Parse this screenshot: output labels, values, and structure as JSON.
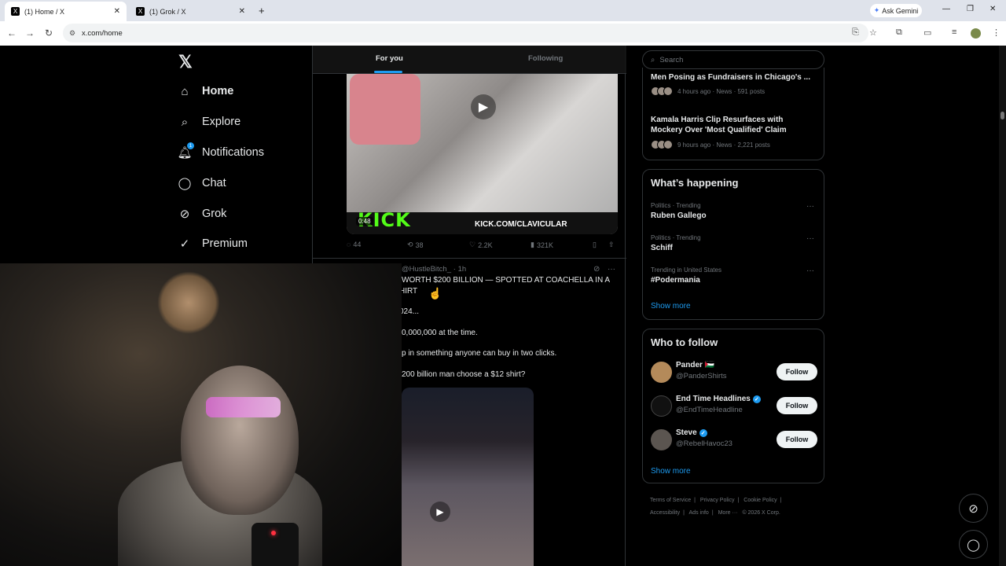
{
  "browser": {
    "tabs": [
      {
        "title": "(1) Home / X"
      },
      {
        "title": "(1) Grok / X"
      }
    ],
    "new_tab": "+",
    "ask_gemini": "Ask Gemini",
    "url": "x.com/home"
  },
  "sidebar": {
    "logo": "𝕏",
    "items": [
      {
        "label": "Home",
        "icon": "home-icon"
      },
      {
        "label": "Explore",
        "icon": "search-icon"
      },
      {
        "label": "Notifications",
        "icon": "bell-icon",
        "badge": "1"
      },
      {
        "label": "Chat",
        "icon": "chat-icon"
      },
      {
        "label": "Grok",
        "icon": "grok-icon"
      },
      {
        "label": "Premium",
        "icon": "premium-icon"
      }
    ]
  },
  "feed": {
    "tabs": [
      {
        "label": "For you"
      },
      {
        "label": "Following"
      }
    ],
    "post1": {
      "video_duration": "0:48",
      "video_brand": "KICK",
      "video_url_text": "KICK.COM/CLAVICULAR",
      "replies": "44",
      "reposts": "38",
      "likes": "2.2K",
      "views": "321K"
    },
    "post2": {
      "handle": "@HustleBitch_",
      "time": "· 1h",
      "lines": [
        "WORTH $200 BILLION — SPOTTED AT COACHELLA IN A",
        "HIRT",
        "024...",
        "0,000,000 at the time.",
        "p in something anyone can buy in two clicks.",
        "200 billion man choose a $12 shirt?"
      ]
    }
  },
  "right": {
    "search_placeholder": "Search",
    "trends_top": [
      {
        "title": "Men Posing as Fundraisers in Chicago's ...",
        "meta": "4 hours ago · News · 591 posts"
      },
      {
        "title": "Kamala Harris Clip Resurfaces with Mockery Over 'Most Qualified' Claim",
        "meta": "9 hours ago · News · 2,221 posts"
      }
    ],
    "happening": {
      "title": "What’s happening",
      "items": [
        {
          "category": "Politics · Trending",
          "name": "Ruben Gallego"
        },
        {
          "category": "Politics · Trending",
          "name": "Schiff"
        },
        {
          "category": "Trending in United States",
          "name": "#Podermania"
        }
      ],
      "show_more": "Show more"
    },
    "who_to_follow": {
      "title": "Who to follow",
      "accounts": [
        {
          "name": "Pander 🇵🇸",
          "handle": "@PanderShirts",
          "verified": false
        },
        {
          "name": "End Time Headlines",
          "handle": "@EndTimeHeadline",
          "verified": true
        },
        {
          "name": "Steve",
          "handle": "@RebelHavoc23",
          "verified": true
        }
      ],
      "follow_label": "Follow",
      "show_more": "Show more"
    },
    "footer": {
      "links": [
        "Terms of Service",
        "Privacy Policy",
        "Cookie Policy",
        "Accessibility",
        "Ads info",
        "More ···"
      ],
      "copyright": "© 2026 X Corp."
    }
  },
  "colors": {
    "accent": "#1d9bf0",
    "background": "#000000",
    "text": "#e7e9ea",
    "muted": "#71767b",
    "kick_green": "#53fc18"
  }
}
